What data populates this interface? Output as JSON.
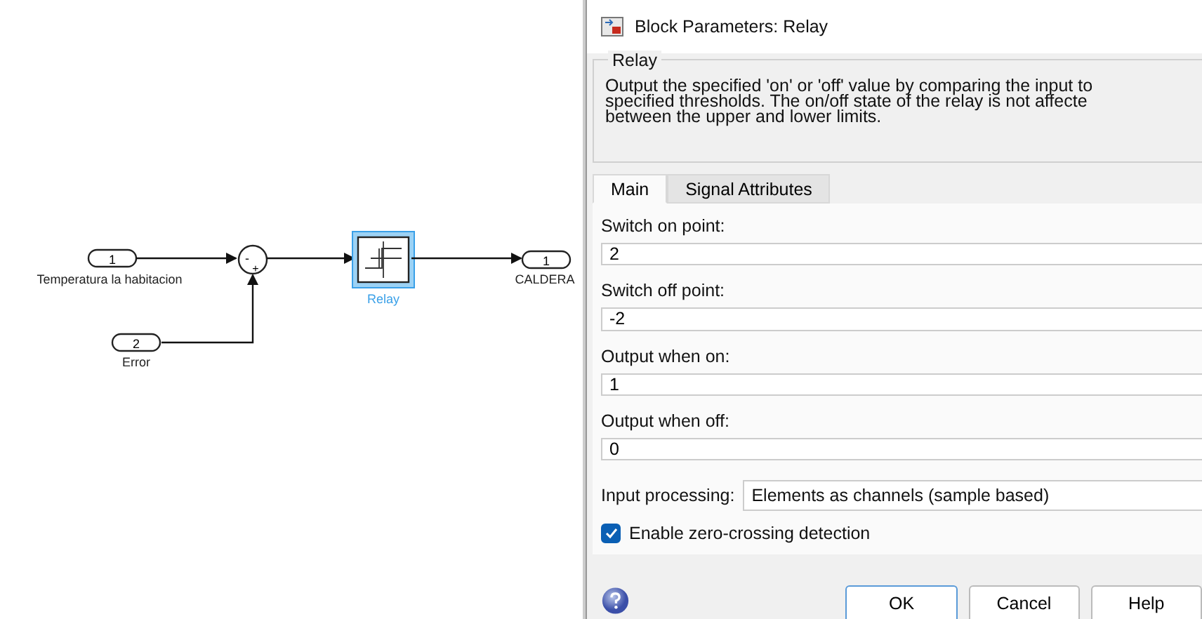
{
  "diagram": {
    "inports": [
      {
        "number": "1",
        "label": "Temperatura la habitacion"
      },
      {
        "number": "2",
        "label": "Error"
      }
    ],
    "sum": {
      "signs": [
        "-",
        "+"
      ]
    },
    "block": {
      "label": "Relay",
      "selected": true
    },
    "outport": {
      "number": "1",
      "label": "CALDERA"
    }
  },
  "dialog": {
    "title": "Block Parameters: Relay",
    "group_title": "Relay",
    "description": [
      "Output the specified 'on' or 'off' value by comparing the input to",
      "specified thresholds.  The on/off state of the relay is not affecte",
      "between the upper and lower limits."
    ],
    "tabs": [
      {
        "label": "Main",
        "selected": true
      },
      {
        "label": "Signal Attributes",
        "selected": false
      }
    ],
    "params": [
      {
        "label": "Switch on point:",
        "value": "2"
      },
      {
        "label": "Switch off point:",
        "value": "-2"
      },
      {
        "label": "Output when on:",
        "value": "1"
      },
      {
        "label": "Output when off:",
        "value": "0"
      }
    ],
    "input_processing": {
      "label": "Input processing:",
      "value": "Elements as channels (sample based)"
    },
    "zero_crossing": {
      "label": "Enable zero-crossing detection",
      "checked": true
    },
    "buttons": [
      "OK",
      "Cancel",
      "Help"
    ]
  }
}
